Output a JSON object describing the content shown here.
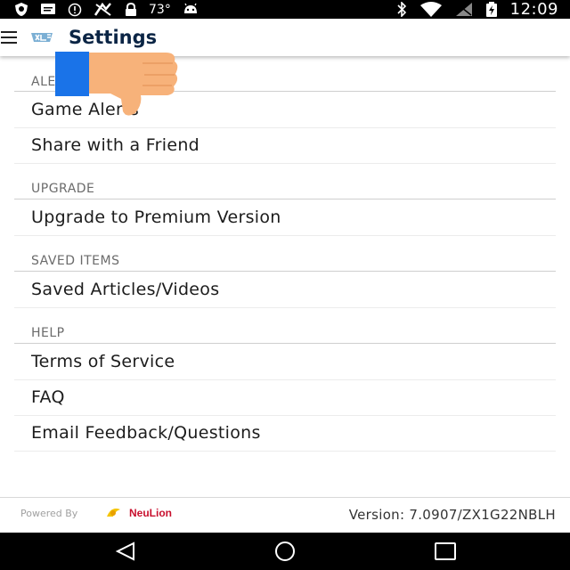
{
  "status_bar": {
    "temperature": "73°",
    "time": "12:09",
    "icons": [
      "shield-icon",
      "message-icon",
      "info-circle-icon",
      "no-signal-icon",
      "lock-icon",
      "android-icon",
      "bluetooth-icon",
      "wifi-icon",
      "no-sim-icon",
      "battery-icon"
    ]
  },
  "app_bar": {
    "menu_icon": "menu-icon",
    "logo_icon": "unc-logo-icon",
    "title": "Settings"
  },
  "sections": [
    {
      "header": "ALERTS",
      "items": [
        "Game Alerts",
        "Share with a Friend"
      ]
    },
    {
      "header": "UPGRADE",
      "items": [
        "Upgrade to Premium Version"
      ]
    },
    {
      "header": "SAVED ITEMS",
      "items": [
        "Saved Articles/Videos"
      ]
    },
    {
      "header": "HELP",
      "items": [
        "Terms of Service",
        "FAQ",
        "Email Feedback/Questions"
      ]
    }
  ],
  "overlay": {
    "icon": "thumbs-down-icon"
  },
  "footer": {
    "powered_by": "Powered By",
    "brand": "NeuLion",
    "version": "Version: 7.0907/ZX1G22NBLH"
  },
  "nav_bar": {
    "back_icon": "back-triangle-icon",
    "home_icon": "home-circle-icon",
    "recents_icon": "recents-square-icon"
  },
  "colors": {
    "title": "#0b2545",
    "section_header": "#6b6b6b",
    "thumb_blue": "#1a73e8",
    "thumb_skin": "#f7b27a"
  }
}
